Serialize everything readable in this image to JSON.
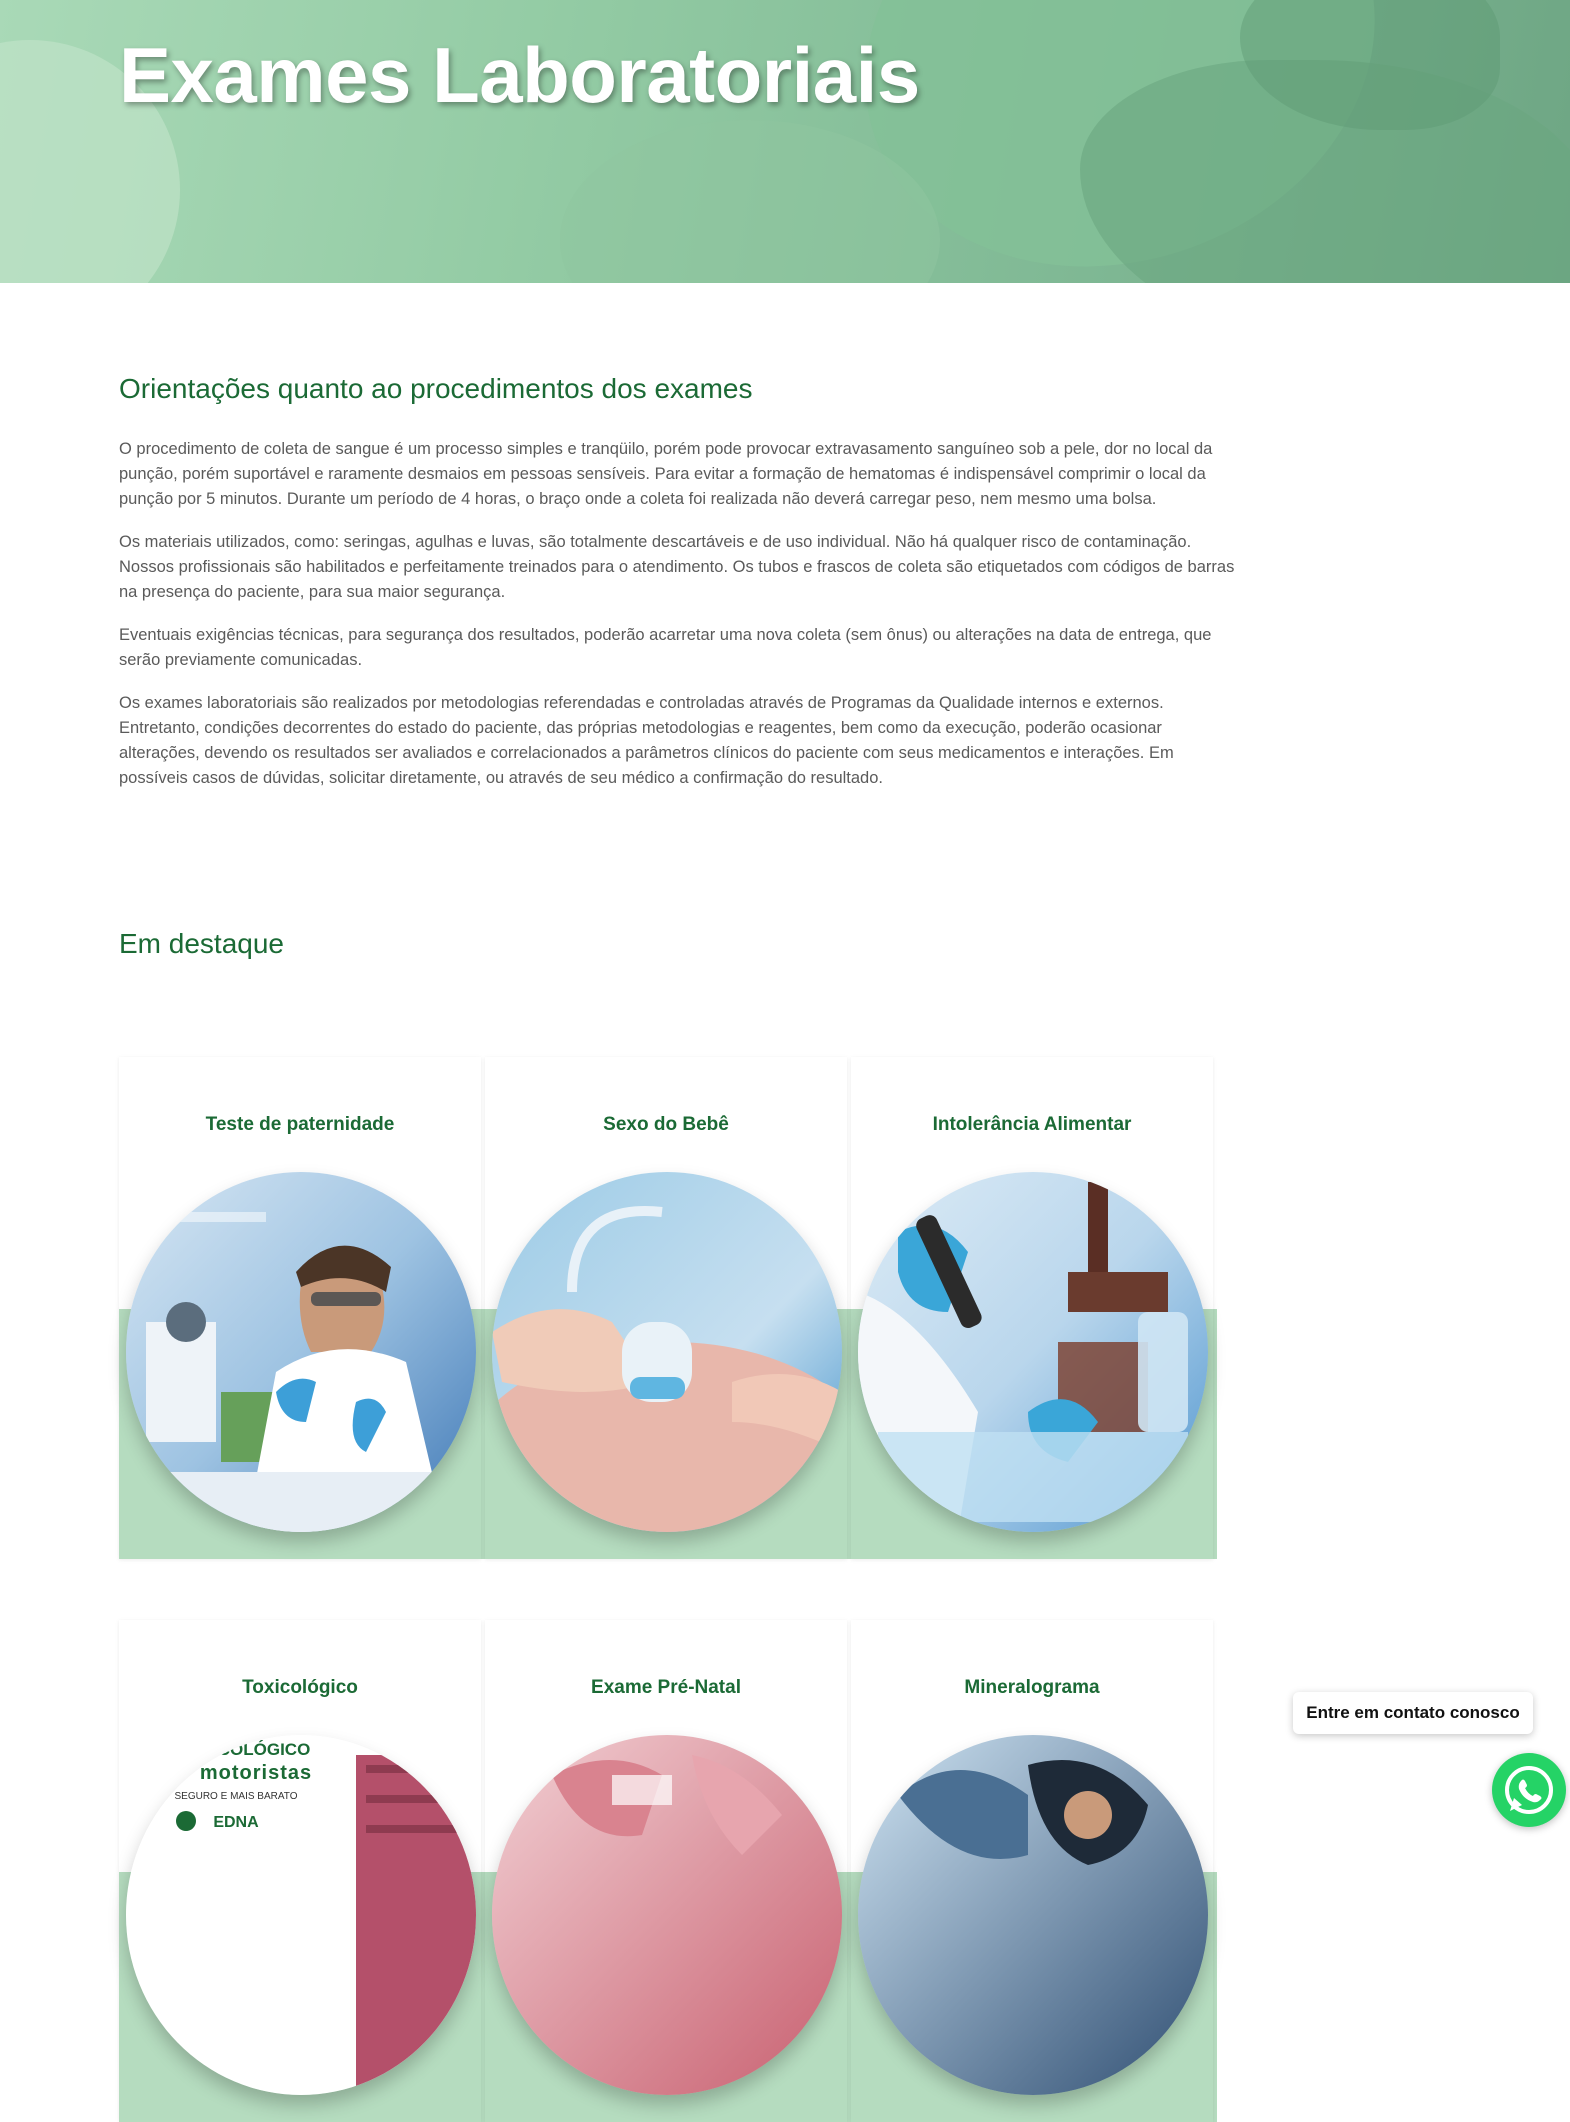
{
  "hero": {
    "title": "Exames Laboratoriais"
  },
  "guidance": {
    "heading": "Orientações quanto ao procedimentos dos exames",
    "paragraphs": [
      "O procedimento de coleta de sangue é um processo simples e tranqüilo, porém pode provocar extravasamento sanguíneo sob a pele, dor no local da punção, porém suportável e raramente desmaios em pessoas sensíveis. Para evitar a formação de hematomas é indispensável comprimir o local da punção por 5 minutos. Durante um período de 4 horas, o braço onde a coleta foi realizada não deverá carregar peso, nem mesmo uma bolsa.",
      "Os materiais utilizados, como: seringas, agulhas e luvas, são totalmente descartáveis e de uso individual. Não há qualquer risco de contaminação. Nossos profissionais são habilitados e perfeitamente treinados para o atendimento. Os tubos e frascos de coleta são etiquetados com códigos de barras na presença do paciente, para sua maior segurança.",
      "Eventuais exigências técnicas, para segurança dos resultados, poderão acarretar uma nova coleta (sem ônus) ou alterações na data de entrega, que serão previamente comunicadas.",
      "Os exames laboratoriais são realizados por metodologias referendadas e controladas através de Programas da Qualidade internos e externos. Entretanto, condições decorrentes do estado do paciente, das próprias metodologias e reagentes, bem como da execução, poderão ocasionar alterações, devendo os resultados ser avaliados e correlacionados a parâmetros clínicos do paciente com seus medicamentos e interações. Em possíveis casos de dúvidas, solicitar diretamente, ou através de seu médico a confirmação do resultado."
    ]
  },
  "featured": {
    "heading": "Em destaque",
    "cards": [
      {
        "title": "Teste de paternidade"
      },
      {
        "title": "Sexo do Bebê"
      },
      {
        "title": "Intolerância Alimentar"
      },
      {
        "title": "Toxicológico",
        "image_text": [
          "XICOLÓGICO",
          "motoristas",
          "SEGURO E MAIS BARATO",
          "EDNA"
        ]
      },
      {
        "title": "Exame Pré-Natal"
      },
      {
        "title": "Mineralograma"
      }
    ]
  },
  "floating": {
    "contact_label": "Entre em contato conosco",
    "whatsapp_icon": "whatsapp-icon",
    "whatsapp_color": "#25d366"
  },
  "colors": {
    "brand_green": "#1b6a35",
    "band_green": "#b5dcbf",
    "hero_green": "#93cba4"
  }
}
